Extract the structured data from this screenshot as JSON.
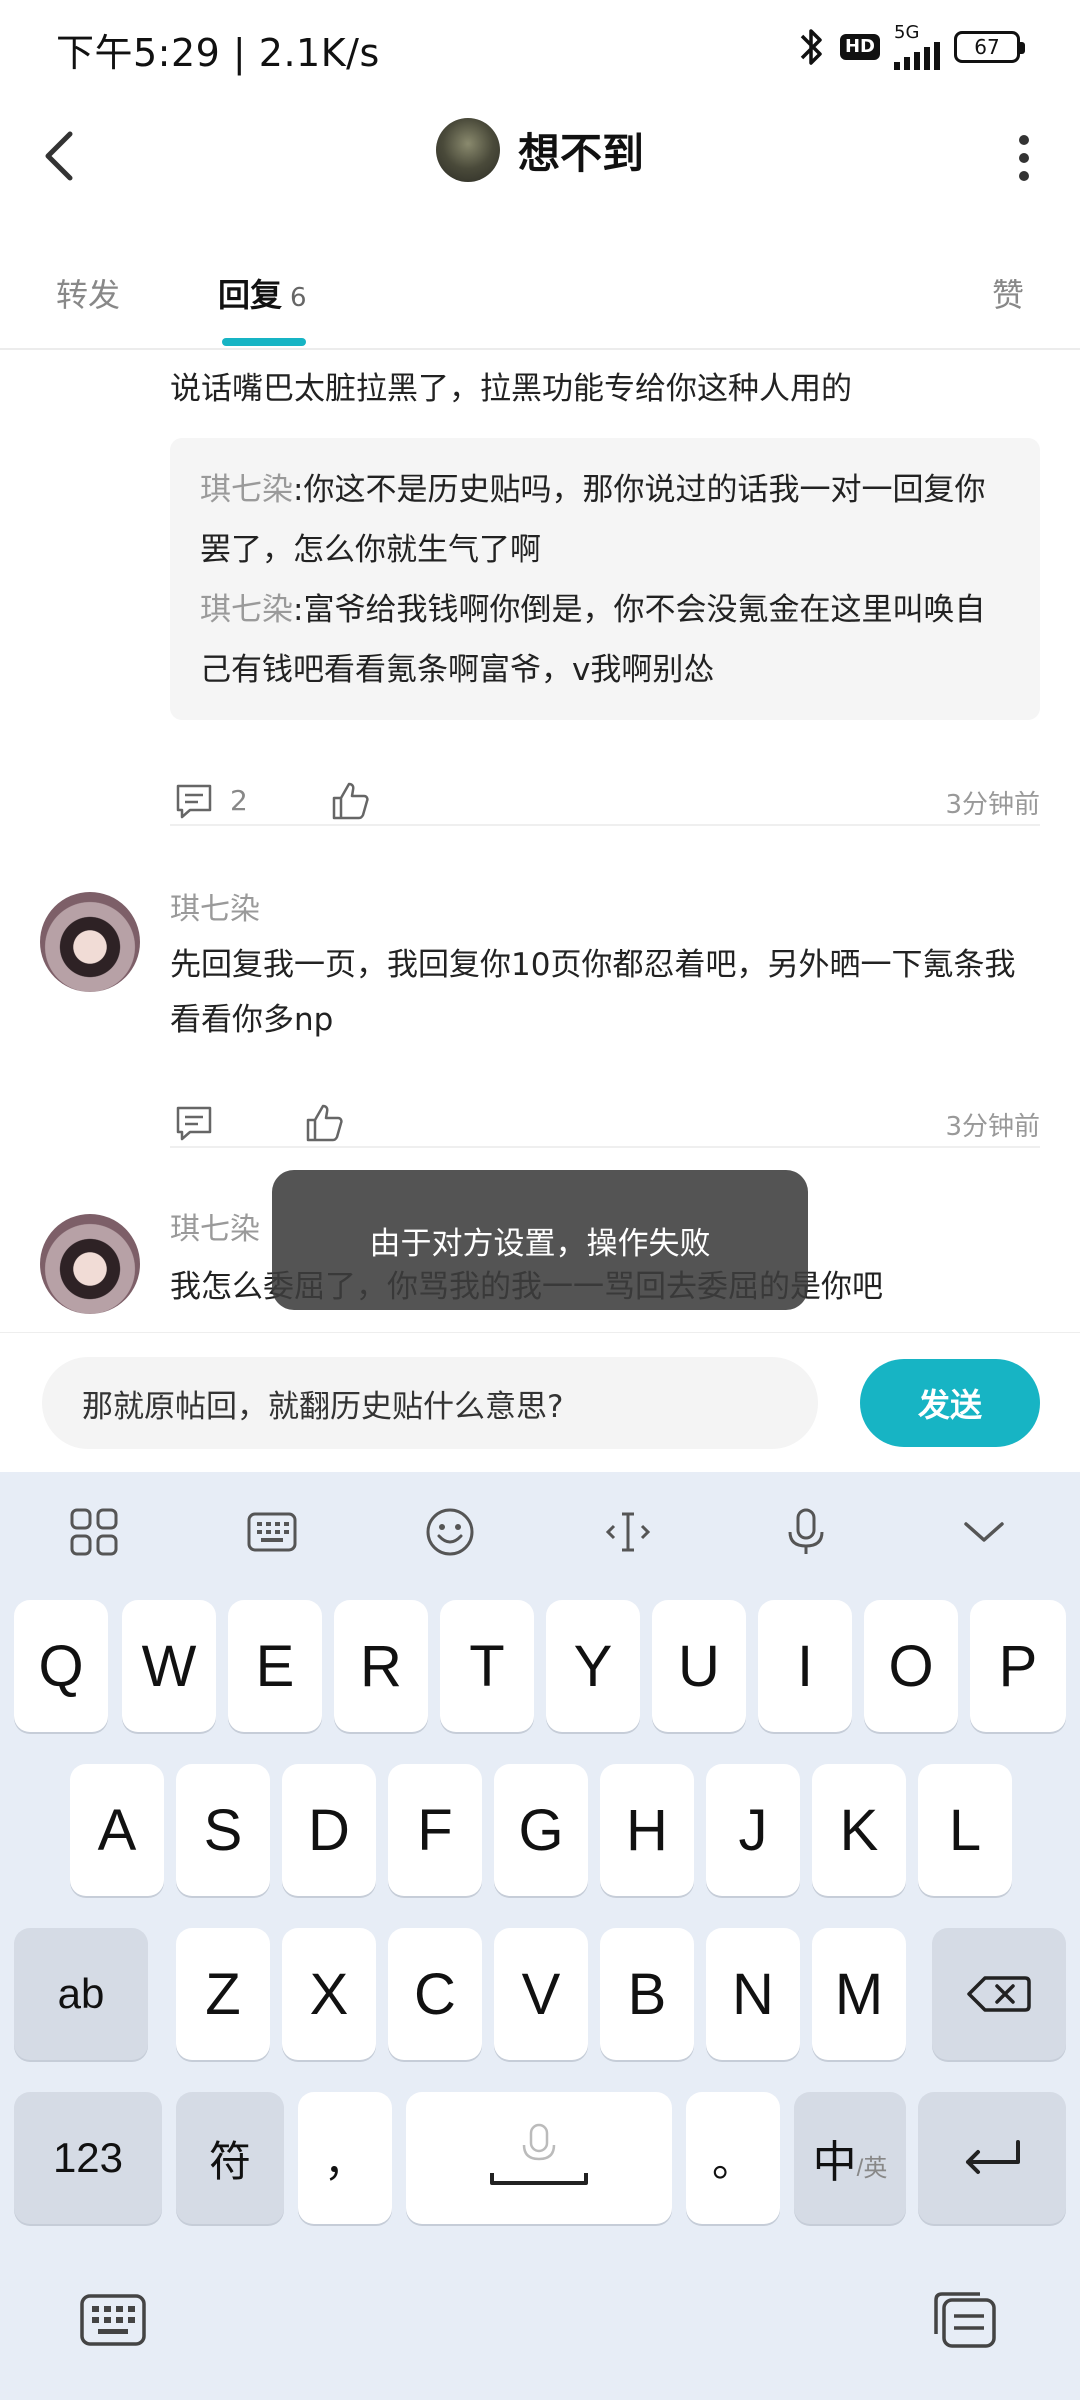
{
  "status_bar": {
    "time": "下午5:29 | 2.1K/s",
    "hd": "HD",
    "network": "5G",
    "battery": "67"
  },
  "header": {
    "title": "想不到"
  },
  "tabs": {
    "forward": "转发",
    "reply": "回复",
    "reply_count": "6",
    "like": "赞"
  },
  "comments": {
    "first": {
      "text": "说话嘴巴太脏拉黑了，拉黑功能专给你这种人用的",
      "quotes": [
        {
          "name": "琪七染",
          "text": ":你这不是历史贴吗，那你说过的话我一对一回复你罢了，怎么你就生气了啊"
        },
        {
          "name": "琪七染",
          "text": ":富爷给我钱啊你倒是，你不会没氪金在这里叫唤自己有钱吧看看氪条啊富爷，v我啊别怂"
        }
      ],
      "comment_count": "2",
      "time": "3分钟前"
    },
    "second": {
      "name": "琪七染",
      "text": "先回复我一页，我回复你10页你都忍着吧，另外晒一下氪条我看看你多np",
      "time": "3分钟前"
    },
    "third": {
      "name": "琪七染",
      "text": "我怎么委屈了，你骂我的我一一骂回去委屈的是你吧"
    }
  },
  "toast": {
    "message": "由于对方设置，操作失败"
  },
  "input": {
    "value": "那就原帖回，就翻历史贴什么意思?",
    "send_label": "发送"
  },
  "keyboard": {
    "row1": [
      "Q",
      "W",
      "E",
      "R",
      "T",
      "Y",
      "U",
      "I",
      "O",
      "P"
    ],
    "row2": [
      "A",
      "S",
      "D",
      "F",
      "G",
      "H",
      "J",
      "K",
      "L"
    ],
    "row3": [
      "Z",
      "X",
      "C",
      "V",
      "B",
      "N",
      "M"
    ],
    "ab": "ab",
    "num": "123",
    "symbol": "符",
    "comma": "，",
    "period": "。",
    "lang_main": "中",
    "lang_alt": "/英"
  },
  "icons": {
    "accent": "#17b4c4"
  }
}
